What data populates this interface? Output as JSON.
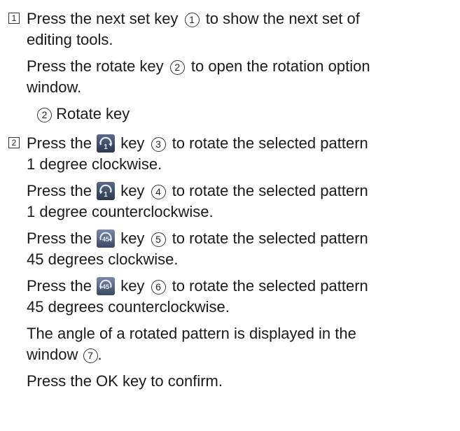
{
  "steps": [
    {
      "number": "1",
      "para1": {
        "pre": "Press the next set key",
        "marker": "1",
        "post": "to show the next set of",
        "line2": "editing tools."
      },
      "para2": {
        "pre": "Press the rotate key",
        "marker": "2",
        "post": "to open the rotation option",
        "line2": "window."
      },
      "sub_item": {
        "marker": "2",
        "label": "Rotate key"
      }
    },
    {
      "number": "2",
      "rotations": [
        {
          "pre": "Press the",
          "icon": "rotate-1-clockwise-icon",
          "post_key": "key",
          "marker": "3",
          "post": "to rotate the selected pattern",
          "line2": "1 degree clockwise."
        },
        {
          "pre": "Press the",
          "icon": "rotate-1-counterclockwise-icon",
          "post_key": "key",
          "marker": "4",
          "post": "to rotate the selected pattern",
          "line2": "1 degree counterclockwise."
        },
        {
          "pre": "Press the",
          "icon": "rotate-45-clockwise-icon",
          "post_key": "key",
          "marker": "5",
          "post": "to rotate the selected pattern",
          "line2": "45 degrees clockwise."
        },
        {
          "pre": "Press the",
          "icon": "rotate-45-counterclockwise-icon",
          "post_key": "key",
          "marker": "6",
          "post": "to rotate the selected pattern",
          "line2": "45 degrees counterclockwise."
        }
      ],
      "angle_note": {
        "line1": "The angle of a rotated pattern is displayed in the",
        "line2_pre": "window",
        "marker": "7",
        "line2_post": "."
      },
      "confirm": "Press the OK key to confirm."
    }
  ],
  "colors": {
    "icon_bg_dark": "#2b3850",
    "icon_bg_light": "#5a6a86",
    "icon_glyph": "#e9eef6"
  },
  "icon_labels": {
    "one": "1",
    "forty_five": "45"
  }
}
